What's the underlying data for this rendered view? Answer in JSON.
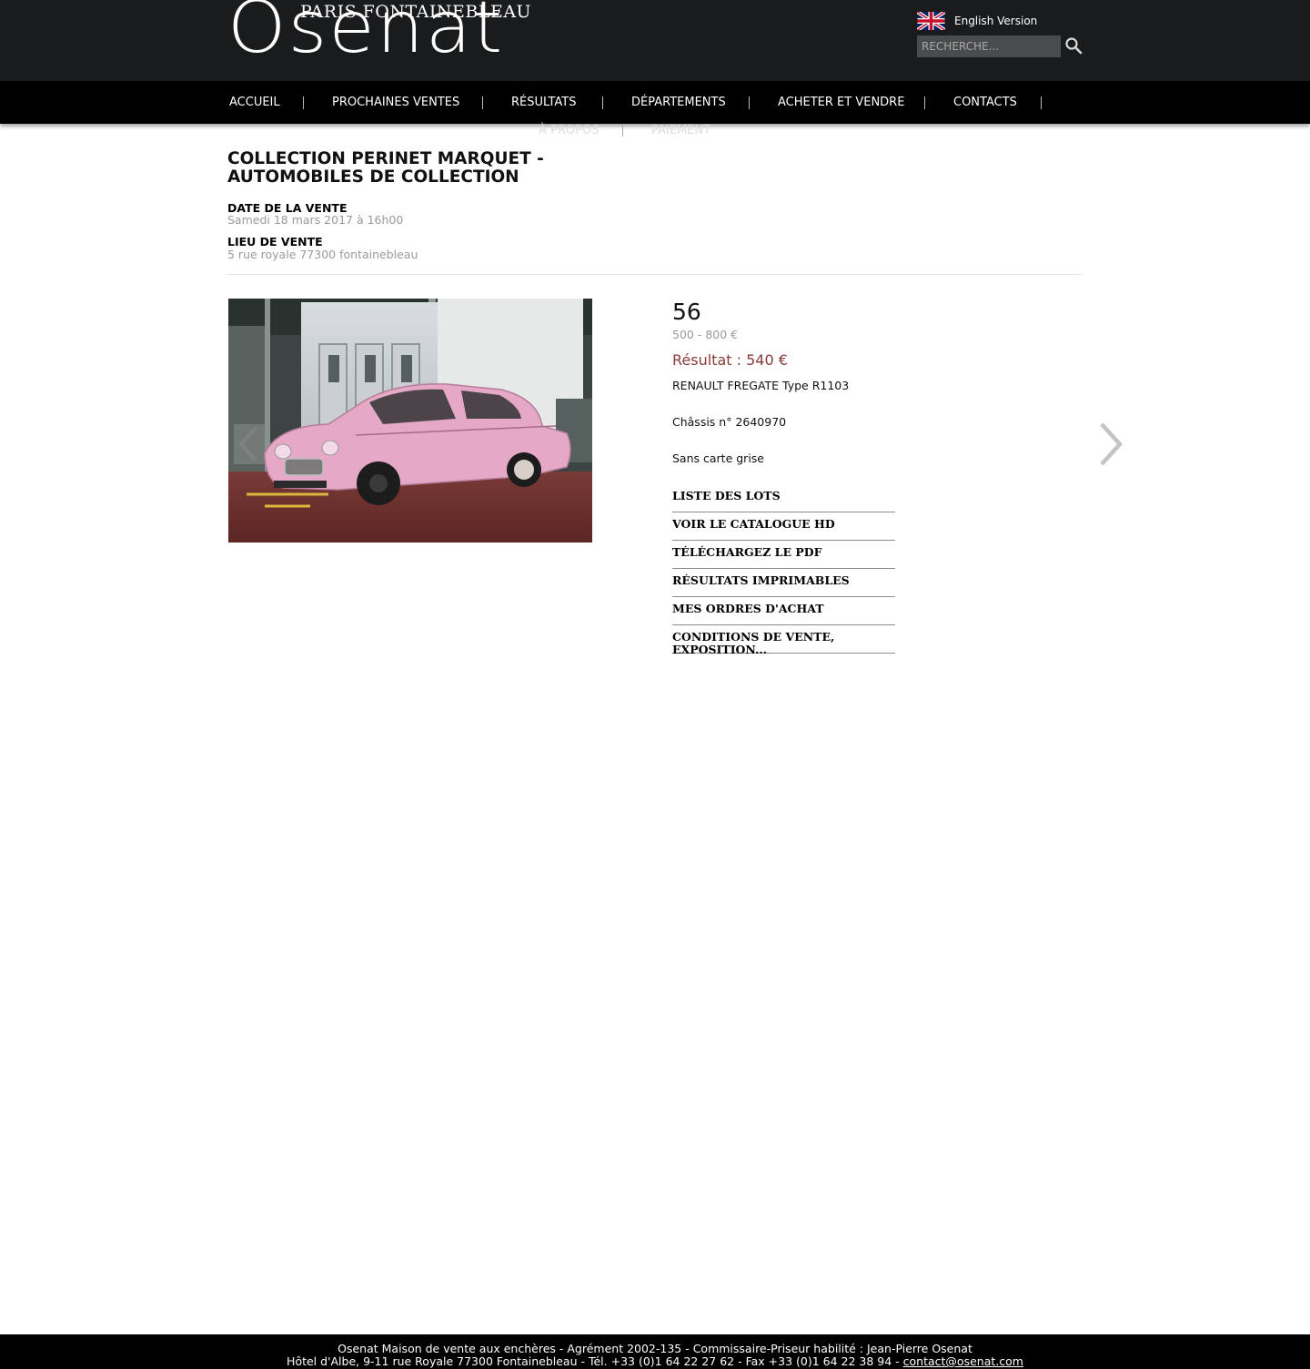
{
  "header": {
    "logo_top": "PARIS FONTAINEBLEAU",
    "logo_main": "Osenat",
    "lang_label": "English Version",
    "search_placeholder": "RECHERCHE..."
  },
  "nav": {
    "items": [
      "ACCUEIL",
      "PROCHAINES VENTES",
      "RÉSULTATS",
      "DÉPARTEMENTS",
      "ACHETER ET VENDRE",
      "CONTACTS",
      "À PROPOS",
      "PAIEMENT"
    ]
  },
  "sale": {
    "title": "COLLECTION PERINET MARQUET - AUTOMOBILES DE COLLECTION",
    "date_label": "DATE DE LA VENTE",
    "date_value": "Samedi 18 mars 2017 à 16h00",
    "place_label": "LIEU DE VENTE",
    "place_value": "5 rue royale 77300 fontainebleau"
  },
  "lot": {
    "number": "56",
    "estimate": "500 - 800 €",
    "result": "Résultat : 540 €",
    "desc_1": "RENAULT FREGATE Type R1103",
    "desc_2": "Châssis n° 2640970",
    "desc_3": "Sans carte grise"
  },
  "links": [
    "LISTE DES LOTS",
    "VOIR LE CATALOGUE HD",
    "TÉLÉCHARGEZ LE PDF",
    "RÉSULTATS IMPRIMABLES",
    "MES ORDRES D'ACHAT",
    "CONDITIONS DE VENTE, EXPOSITION..."
  ],
  "footer": {
    "line1": "Osenat Maison de vente aux enchères - Agrément 2002-135 - Commissaire-Priseur habilité : Jean-Pierre Osenat",
    "line2_text": "Hôtel d'Albe, 9-11 rue Royale 77300 Fontainebleau - Tél. +33 (0)1 64 22 27 62 - Fax +33 (0)1 64 22 38 94 - ",
    "email": "contact@osenat.com"
  },
  "colors": {
    "header_bg": "#1a1b1d",
    "nav_bg": "#000000",
    "result_color": "#8a3a3a",
    "muted_text": "#9a9a9a"
  },
  "icons": [
    "uk-flag-icon",
    "search-icon",
    "chevron-left-icon",
    "chevron-right-icon"
  ]
}
